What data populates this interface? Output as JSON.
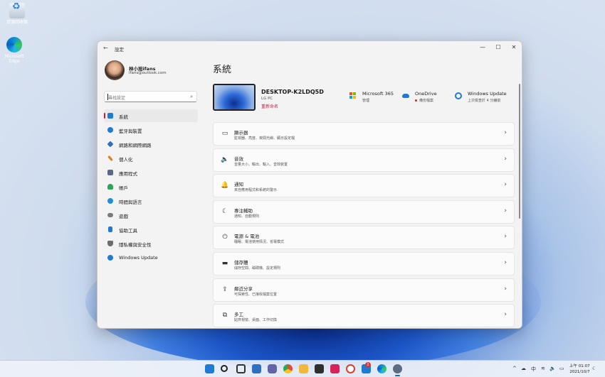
{
  "desktop": {
    "icons": [
      {
        "label": "資源回收筒",
        "icon": "recycle-bin-icon"
      },
      {
        "label": "Microsoft Edge",
        "icon": "edge-icon"
      }
    ]
  },
  "window": {
    "title": "設定",
    "controls": {
      "minimize": "—",
      "maximize": "☐",
      "close": "✕"
    }
  },
  "profile": {
    "name": "林小旭ifans",
    "email": "ifans@outlook.com"
  },
  "search": {
    "placeholder": "尋找設定"
  },
  "sidebar": {
    "items": [
      {
        "label": "系統",
        "icon": "system-icon",
        "color": "#1f7ad6",
        "active": true
      },
      {
        "label": "藍牙與裝置",
        "icon": "bluetooth-icon",
        "color": "#1f7ad6"
      },
      {
        "label": "網路和網際網路",
        "icon": "network-icon",
        "color": "#2f6fc2"
      },
      {
        "label": "個人化",
        "icon": "brush-icon",
        "color": "#d9822b"
      },
      {
        "label": "應用程式",
        "icon": "apps-icon",
        "color": "#5a6a85"
      },
      {
        "label": "帳戶",
        "icon": "account-icon",
        "color": "#2aa65a"
      },
      {
        "label": "時間與語言",
        "icon": "time-language-icon",
        "color": "#1f8fd6"
      },
      {
        "label": "遊戲",
        "icon": "gaming-icon",
        "color": "#7a7a7a"
      },
      {
        "label": "協助工具",
        "icon": "accessibility-icon",
        "color": "#1f7ad6"
      },
      {
        "label": "隱私權與安全性",
        "icon": "shield-icon",
        "color": "#6d6d6d"
      },
      {
        "label": "Windows Update",
        "icon": "windows-update-icon",
        "color": "#1f7ad6"
      }
    ]
  },
  "main": {
    "title": "系統",
    "device": {
      "name": "DESKTOP-K2LDQ5D",
      "model": "LG PC",
      "rename": "重新命名"
    },
    "services": [
      {
        "title": "Microsoft 365",
        "subtitle": "管理",
        "icon": "microsoft-365-icon"
      },
      {
        "title": "OneDrive",
        "subtitle": "備份檔案",
        "icon": "onedrive-icon"
      },
      {
        "title": "Windows Update",
        "subtitle": "上次檢查於 4 分鐘前",
        "icon": "windows-update-icon"
      }
    ],
    "rows": [
      {
        "title": "顯示器",
        "subtitle": "監視器、亮度、夜間光線、顯示設定檔",
        "icon": "display-icon",
        "glyph": "▭"
      },
      {
        "title": "音效",
        "subtitle": "音量大小、輸出、輸入、音效裝置",
        "icon": "sound-icon",
        "glyph": "🔈"
      },
      {
        "title": "通知",
        "subtitle": "來自應用程式和系統的警示",
        "icon": "notification-icon",
        "glyph": "🔔"
      },
      {
        "title": "專注輔助",
        "subtitle": "通知、自動規則",
        "icon": "focus-assist-icon",
        "glyph": "☾"
      },
      {
        "title": "電源 & 電池",
        "subtitle": "睡眠、電池使用情況、省電模式",
        "icon": "power-icon",
        "glyph": "⏻"
      },
      {
        "title": "儲存體",
        "subtitle": "儲存空間、磁碟機、設定規則",
        "icon": "storage-icon",
        "glyph": "▬"
      },
      {
        "title": "鄰近分享",
        "subtitle": "可探索性、已接收檔案位置",
        "icon": "nearby-sharing-icon",
        "glyph": "⇪"
      },
      {
        "title": "多工",
        "subtitle": "貼齊視窗、桌面、工作切換",
        "icon": "multitasking-icon",
        "glyph": "⧉"
      }
    ]
  },
  "taskbar": {
    "apps": [
      {
        "icon": "start-icon",
        "color": "#1f7ad6"
      },
      {
        "icon": "search-icon",
        "color": "#222222"
      },
      {
        "icon": "task-view-icon",
        "color": "#333333"
      },
      {
        "icon": "widgets-icon",
        "color": "#2f6fc2"
      },
      {
        "icon": "teams-chat-icon",
        "color": "#6264a7"
      },
      {
        "icon": "chrome-icon",
        "color": "#e5483b"
      },
      {
        "icon": "file-explorer-icon",
        "color": "#f0b93b"
      },
      {
        "icon": "store-icon",
        "color": "#2f2f2f"
      },
      {
        "icon": "app-pink-icon",
        "color": "#d6245a"
      },
      {
        "icon": "app-red-icon",
        "color": "#d9412f"
      },
      {
        "icon": "mail-icon",
        "color": "#1f7ad6"
      },
      {
        "icon": "edge-icon",
        "color": "#0f8fd8"
      },
      {
        "icon": "settings-icon",
        "color": "#5b6b80"
      }
    ],
    "mail_badge": "1",
    "tray": {
      "chevron": "^",
      "weather": "☁",
      "ime": "中",
      "ime_glyph": "⌨",
      "wifi": "≋",
      "volume": "🔈",
      "battery": "▭"
    },
    "time": "上午 01:07",
    "date": "2021/10/7"
  }
}
